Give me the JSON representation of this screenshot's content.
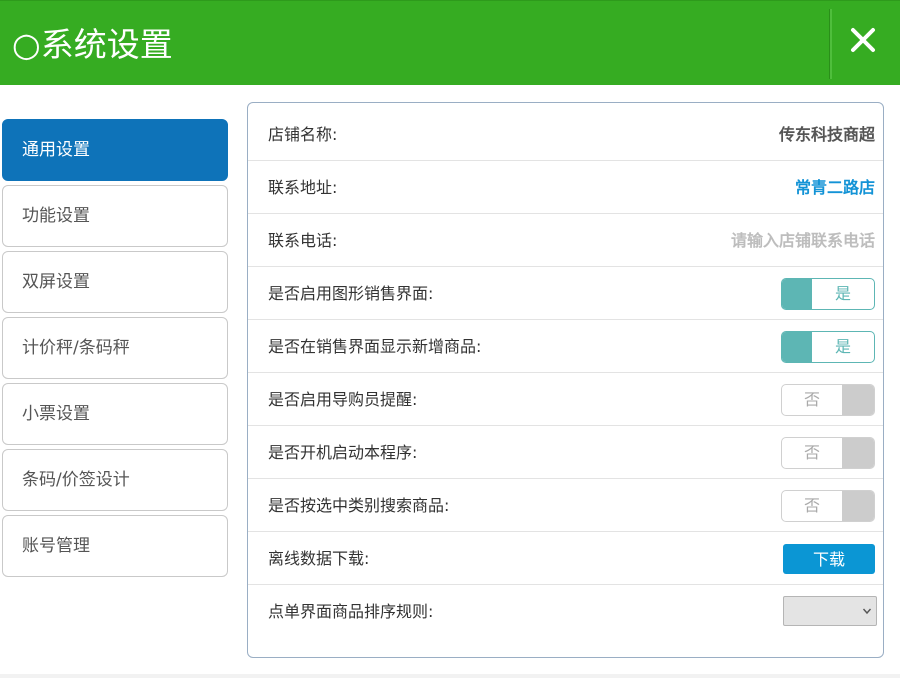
{
  "header": {
    "title": "○系统设置",
    "close_icon": "close-icon",
    "background_color": "#36ac22"
  },
  "sidebar": {
    "items": [
      {
        "label": "通用设置",
        "active": true
      },
      {
        "label": "功能设置",
        "active": false
      },
      {
        "label": "双屏设置",
        "active": false
      },
      {
        "label": "计价秤/条码秤",
        "active": false
      },
      {
        "label": "小票设置",
        "active": false
      },
      {
        "label": "条码/价签设计",
        "active": false
      },
      {
        "label": "账号管理",
        "active": false
      }
    ],
    "active_color": "#0e73b9"
  },
  "settings": {
    "store_name": {
      "label": "店铺名称:",
      "value": "传东科技商超"
    },
    "address": {
      "label": "联系地址:",
      "value": "常青二路店"
    },
    "phone": {
      "label": "联系电话:",
      "value": "",
      "placeholder": "请输入店铺联系电话"
    },
    "graphic_sales_ui": {
      "label": "是否启用图形销售界面:",
      "state": "是",
      "on": true
    },
    "show_new_products": {
      "label": "是否在销售界面显示新增商品:",
      "state": "是",
      "on": true
    },
    "shopping_guide_reminder": {
      "label": "是否启用导购员提醒:",
      "state": "否",
      "on": false
    },
    "autostart": {
      "label": "是否开机启动本程序:",
      "state": "否",
      "on": false
    },
    "search_by_category": {
      "label": "是否按选中类别搜索商品:",
      "state": "否",
      "on": false
    },
    "offline_download": {
      "label": "离线数据下载:",
      "button": "下载"
    },
    "order_sort_rule": {
      "label": "点单界面商品排序规则:",
      "selected": ""
    }
  },
  "colors": {
    "toggle_on": "#5db6b4",
    "toggle_off": "#cccccc",
    "download_button": "#0b96d4",
    "address_value": "#1393d6"
  }
}
